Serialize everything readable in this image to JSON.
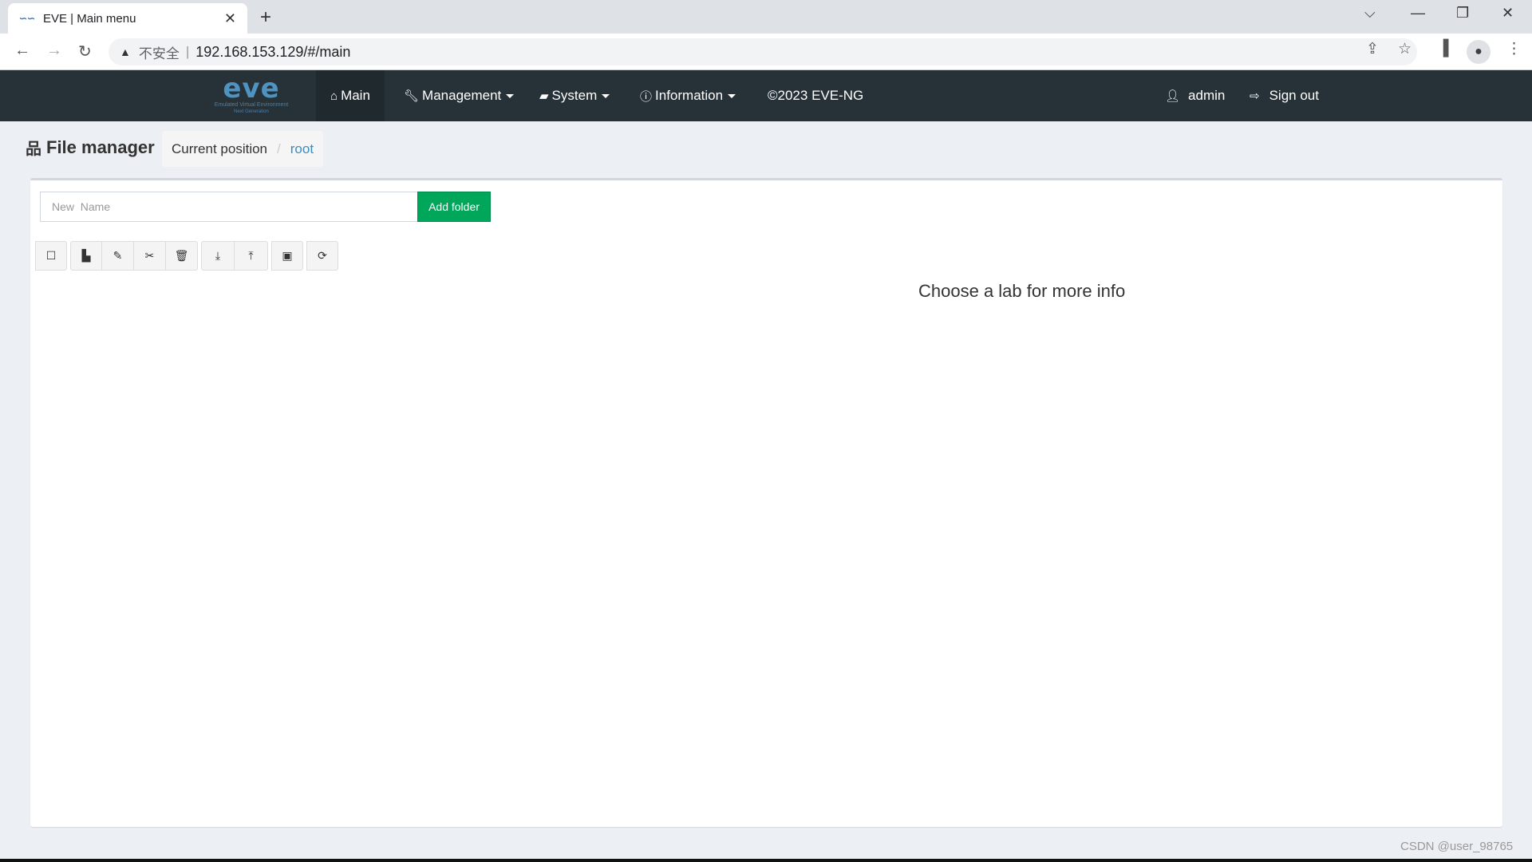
{
  "browser": {
    "tab_title": "EVE | Main menu",
    "tab_favicon": "eve-logo-icon",
    "new_tab_label": "+",
    "security_label": "不安全",
    "url": "192.168.153.129/#/main",
    "window_controls": [
      "chevron-down-icon",
      "minimize-icon",
      "restore-icon",
      "close-icon"
    ]
  },
  "navbar": {
    "logo_text": "eve",
    "logo_subtitle": "Emulated Virtual Environment",
    "logo_subtitle2": "Next Generation",
    "items": [
      {
        "label": "Main",
        "icon": "home-icon",
        "dropdown": false,
        "active": true
      },
      {
        "label": "Management",
        "icon": "wrench-icon",
        "dropdown": true
      },
      {
        "label": "System",
        "icon": "book-icon",
        "dropdown": true
      },
      {
        "label": "Information",
        "icon": "info-icon",
        "dropdown": true
      },
      {
        "label": "©2023 EVE-NG",
        "icon": null,
        "dropdown": false
      }
    ],
    "user": {
      "label": "admin",
      "icon": "user-icon"
    },
    "signout": {
      "label": "Sign out",
      "icon": "sign-out-icon"
    }
  },
  "page": {
    "title": "File manager",
    "title_icon": "sitemap-icon",
    "breadcrumb": {
      "label": "Current position",
      "separator": "/",
      "current": "root"
    }
  },
  "panel": {
    "new_name_placeholder": "New  Name",
    "new_name_value": "",
    "add_folder_label": "Add folder",
    "toolbar": [
      {
        "group": 1,
        "icons": [
          "select-all-icon"
        ]
      },
      {
        "group": 2,
        "icons": [
          "new-lab-icon",
          "rename-icon",
          "cut-icon",
          "delete-icon"
        ]
      },
      {
        "group": 3,
        "icons": [
          "export-icon",
          "import-icon"
        ]
      },
      {
        "group": 4,
        "icons": [
          "collapse-icon"
        ]
      },
      {
        "group": 5,
        "icons": [
          "refresh-icon"
        ]
      }
    ],
    "lab_info_text": "Choose a lab for more info"
  },
  "watermark": "CSDN @user_98765",
  "colors": {
    "navbar_bg": "#263238",
    "add_button": "#00a65a",
    "link": "#3c8dbc",
    "page_bg": "#eceff3"
  }
}
